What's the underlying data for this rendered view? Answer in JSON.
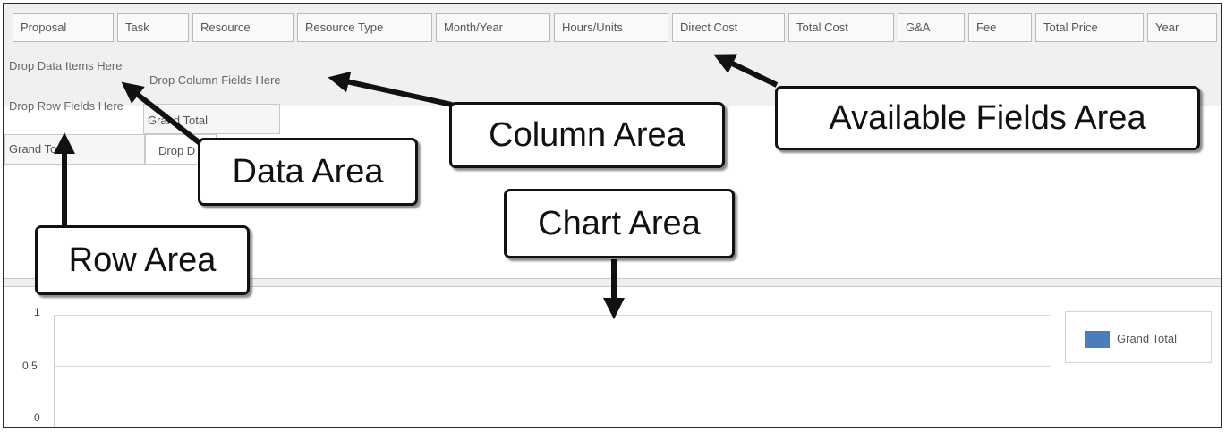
{
  "available_fields": [
    "Proposal",
    "Task",
    "Resource",
    "Resource Type",
    "Month/Year",
    "Hours/Units",
    "Direct Cost",
    "Total Cost",
    "G&A",
    "Fee",
    "Total Price",
    "Year"
  ],
  "drop_zones": {
    "data_items": "Drop Data Items Here",
    "column_fields": "Drop Column Fields Here",
    "row_fields": "Drop Row Fields Here"
  },
  "pivot": {
    "column_grand_total": "Grand Total",
    "row_grand_total": "Grand Total",
    "partial_drop_cell": "Drop D"
  },
  "chart": {
    "y_ticks": [
      "1",
      "0.5",
      "0"
    ],
    "legend_label": "Grand Total",
    "series_color": "#4a7ebb"
  },
  "callouts": {
    "available_fields": "Available Fields Area",
    "column_area": "Column Area",
    "data_area": "Data Area",
    "chart_area": "Chart Area",
    "row_area": "Row Area"
  }
}
